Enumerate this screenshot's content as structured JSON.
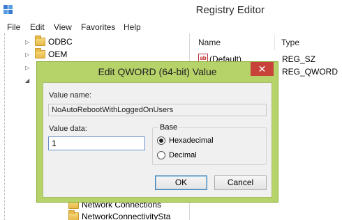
{
  "window": {
    "title": "Registry Editor"
  },
  "menu": [
    "File",
    "Edit",
    "View",
    "Favorites",
    "Help"
  ],
  "tree": {
    "items": [
      "ODBC",
      "OEM"
    ],
    "below_items": [
      "Network Connections",
      "NetworkConnectivitySta"
    ]
  },
  "list": {
    "columns": {
      "name": "Name",
      "type": "Type"
    },
    "rows": [
      {
        "name": "(Default)",
        "type": "REG_SZ",
        "icon": "ab-string-icon"
      },
      {
        "name": "",
        "type": "REG_QWORD",
        "icon": "binary-value-icon"
      }
    ]
  },
  "dialog": {
    "title": "Edit QWORD (64-bit) Value",
    "close_glyph": "✕",
    "value_name_label": "Value name:",
    "value_name": "NoAutoRebootWithLoggedOnUsers",
    "value_data_label": "Value data:",
    "value_data": "1",
    "base_label": "Base",
    "base_options": [
      "Hexadecimal",
      "Decimal"
    ],
    "base_selected": "Hexadecimal",
    "ok_label": "OK",
    "cancel_label": "Cancel"
  },
  "colors": {
    "dialog_frame": "#b6d36a",
    "close_button": "#c7433a"
  }
}
